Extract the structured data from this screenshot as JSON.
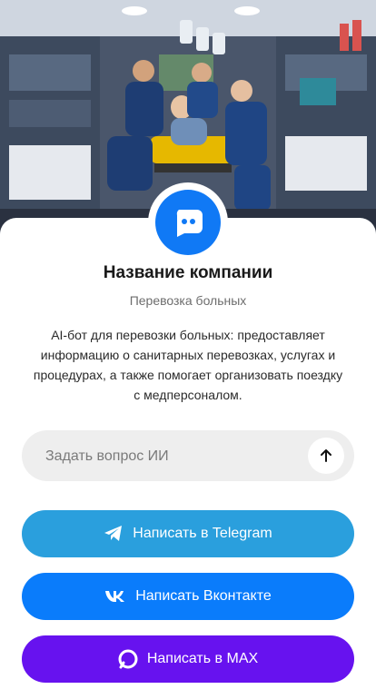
{
  "colors": {
    "logo": "#1079f5",
    "telegram": "#2a9fdd",
    "vk": "#0a7cfb",
    "max": "#6712ef"
  },
  "company": {
    "name": "Название компании",
    "category": "Перевозка больных",
    "description": "AI-бот для перевозки больных: предоставляет информацию о санитарных перевозках, услугах и процедурах, а также помогает организовать поездку с медперсоналом."
  },
  "ask": {
    "placeholder": "Задать вопрос ИИ"
  },
  "buttons": {
    "telegram": "Написать в Telegram",
    "vk": "Написать Вконтакте",
    "max": "Написать в MAX"
  },
  "icons": {
    "logo": "chat-bubble-icon",
    "send": "arrow-up-icon",
    "telegram": "telegram-icon",
    "vk": "vk-icon",
    "max": "max-icon"
  }
}
